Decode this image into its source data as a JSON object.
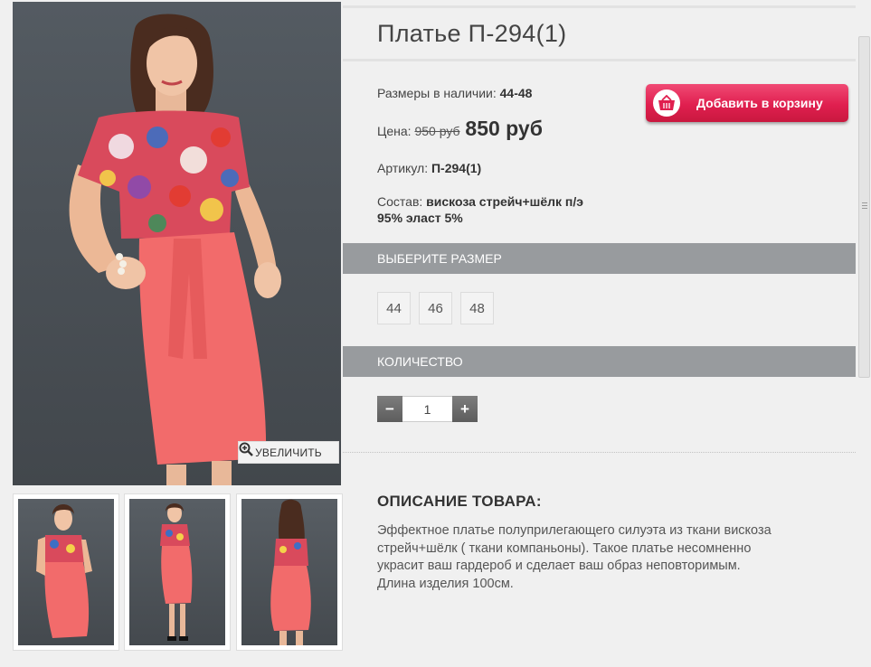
{
  "product": {
    "title": "Платье П-294(1)",
    "sizes_label": "Размеры в наличии:",
    "sizes_value": "44-48",
    "price_label": "Цена:",
    "old_price": "950 руб",
    "new_price": "850 руб",
    "sku_label": "Артикул:",
    "sku_value": "П-294(1)",
    "composition_label": "Состав:",
    "composition_value_line1": "вискоза стрейч+шёлк п/э",
    "composition_value_line2": "95% эласт 5%"
  },
  "cart_button": {
    "label": "Добавить в корзину",
    "icon": "basket-icon"
  },
  "gallery": {
    "zoom_label": "УВЕЛИЧИТЬ",
    "zoom_icon": "magnifier-plus-icon",
    "thumbnail_count": 3
  },
  "size_section": {
    "title": "ВЫБЕРИТЕ РАЗМЕР",
    "options": [
      "44",
      "46",
      "48"
    ]
  },
  "quantity_section": {
    "title": "КОЛИЧЕСТВО",
    "value": "1",
    "minus": "−",
    "plus": "+"
  },
  "description": {
    "title": "ОПИСАНИЕ ТОВАРА:",
    "line1": "Эффектное платье полуприлегающего силуэта из ткани вискоза",
    "line2": "стрейч+шёлк ( ткани компаньоны). Такое платье несомненно",
    "line3": "украсит ваш гардероб и сделает ваш образ неповторимым.",
    "line4": "Длина изделия 100см."
  },
  "colors": {
    "accent_button": "#e01f4f",
    "section_bar": "#989b9e",
    "background": "#f0f0f0",
    "skirt": "#f26b6b"
  }
}
